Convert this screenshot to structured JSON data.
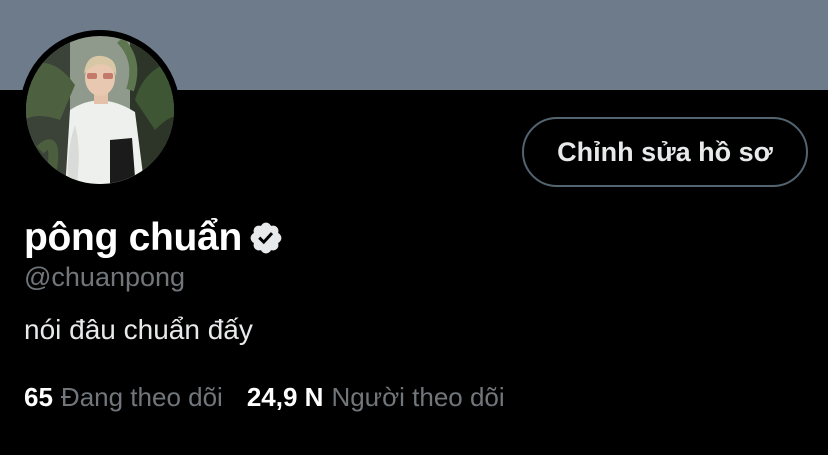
{
  "colors": {
    "banner": "#6e7b8b",
    "background": "#000000",
    "text_primary": "#ffffff",
    "text_secondary": "#71767b",
    "button_border": "#536471"
  },
  "profile": {
    "display_name": "pông chuẩn",
    "verified_icon": "verified-badge-icon",
    "handle": "@chuanpong",
    "bio": "nói đâu chuẩn đấy",
    "edit_button_label": "Chỉnh sửa hồ sơ"
  },
  "stats": {
    "following_count": "65",
    "following_label": "Đang theo dõi",
    "followers_count": "24,9 N",
    "followers_label": "Người theo dõi"
  }
}
